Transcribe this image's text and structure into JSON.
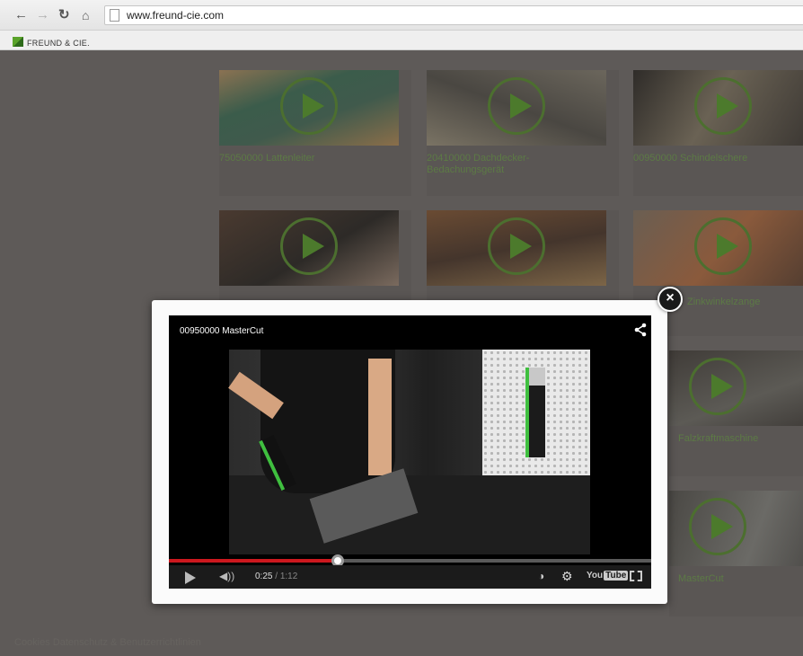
{
  "browser": {
    "url": "www.freund-cie.com",
    "bookmark_label": "FREUND & CIE."
  },
  "site": {
    "cards": [
      {
        "title": "75050000 Lattenleiter"
      },
      {
        "title": "20410000 Dachdecker-Bedachungsgerät"
      },
      {
        "title": "00950000 Schindelschere"
      },
      {
        "title": ""
      },
      {
        "title": ""
      },
      {
        "title": "Zinkwinkelzange"
      },
      {
        "title": "Falzkraftmaschine"
      },
      {
        "title": "MasterCut"
      }
    ],
    "footer_text": "Cookies Datenschutz & Benutzerrichtlinien"
  },
  "modal": {
    "close_symbol": "×",
    "video": {
      "title": "00950000 MasterCut",
      "current_time": "0:25",
      "time_separator": " / ",
      "duration": "1:12",
      "progress_fraction": 0.35,
      "youtube_label": "You",
      "youtube_box": "Tube"
    }
  },
  "colors": {
    "accent": "#4c7a2c",
    "progress": "#cc181e"
  }
}
